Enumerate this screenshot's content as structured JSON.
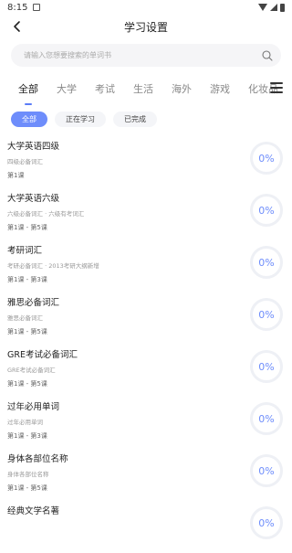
{
  "status_bar": {
    "time": "8:15"
  },
  "header": {
    "title": "学习设置"
  },
  "search": {
    "placeholder": "请输入您想要搜索的单词书"
  },
  "categories": [
    "全部",
    "大学",
    "考试",
    "生活",
    "海外",
    "游戏",
    "化妆品"
  ],
  "filters": [
    "全部",
    "正在学习",
    "已完成"
  ],
  "courses": [
    {
      "name": "大学英语四级",
      "desc": "四级必备词汇",
      "lessons": "第1课",
      "progress": "0%"
    },
    {
      "name": "大学英语六级",
      "desc": "六级必备词汇 · 六级有考词汇",
      "lessons": "第1课 - 第5课",
      "progress": "0%"
    },
    {
      "name": "考研词汇",
      "desc": "考研必备词汇 · 2013考研大纲新增",
      "lessons": "第1课 - 第3课",
      "progress": "0%"
    },
    {
      "name": "雅思必备词汇",
      "desc": "雅思必备词汇",
      "lessons": "第1课 - 第5课",
      "progress": "0%"
    },
    {
      "name": "GRE考试必备词汇",
      "desc": "GRE考试必备词汇",
      "lessons": "第1课 - 第5课",
      "progress": "0%"
    },
    {
      "name": "过年必用单词",
      "desc": "过年必用单词",
      "lessons": "第1课 - 第3课",
      "progress": "0%"
    },
    {
      "name": "身体各部位名称",
      "desc": "身体各部位名称",
      "lessons": "第1课 - 第5课",
      "progress": "0%"
    },
    {
      "name": "经典文学名著",
      "desc": "",
      "lessons": "",
      "progress": "0%"
    }
  ],
  "colors": {
    "accent": "#6e8dfb",
    "tab_indicator": "#5b7cf7",
    "ring": "#eef0f5"
  }
}
